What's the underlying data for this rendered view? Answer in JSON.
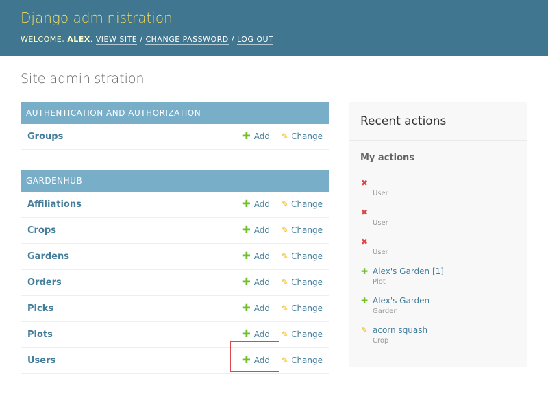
{
  "header": {
    "title": "Django administration",
    "welcome": "Welcome,",
    "user": "alex",
    "view_site": "View site",
    "change_password": "Change password",
    "log_out": "Log out"
  },
  "page_title": "Site administration",
  "modules": [
    {
      "caption": "Authentication and Authorization",
      "rows": [
        {
          "model": "Groups",
          "add": "Add",
          "change": "Change"
        }
      ]
    },
    {
      "caption": "Gardenhub",
      "rows": [
        {
          "model": "Affiliations",
          "add": "Add",
          "change": "Change"
        },
        {
          "model": "Crops",
          "add": "Add",
          "change": "Change"
        },
        {
          "model": "Gardens",
          "add": "Add",
          "change": "Change"
        },
        {
          "model": "Orders",
          "add": "Add",
          "change": "Change"
        },
        {
          "model": "Picks",
          "add": "Add",
          "change": "Change"
        },
        {
          "model": "Plots",
          "add": "Add",
          "change": "Change"
        },
        {
          "model": "Users",
          "add": "Add",
          "change": "Change"
        }
      ]
    }
  ],
  "recent": {
    "title": "Recent actions",
    "subtitle": "My actions",
    "items": [
      {
        "icon": "delete-icon",
        "name": "",
        "type": "User"
      },
      {
        "icon": "delete-icon",
        "name": "",
        "type": "User"
      },
      {
        "icon": "delete-icon",
        "name": "",
        "type": "User"
      },
      {
        "icon": "add-icon",
        "name": "Alex's Garden [1]",
        "type": "Plot"
      },
      {
        "icon": "add-icon",
        "name": "Alex's Garden",
        "type": "Garden"
      },
      {
        "icon": "change-icon",
        "name": "acorn squash",
        "type": "Crop"
      }
    ]
  },
  "colors": {
    "header_bg": "#417690",
    "branding": "#f5dd5d",
    "module_caption_bg": "#79aec8",
    "link": "#447e9b",
    "add_green": "#70bf2b",
    "change_yellow": "#efb80b",
    "delete_red": "#dd4646",
    "highlight_red": "#e0474c"
  }
}
